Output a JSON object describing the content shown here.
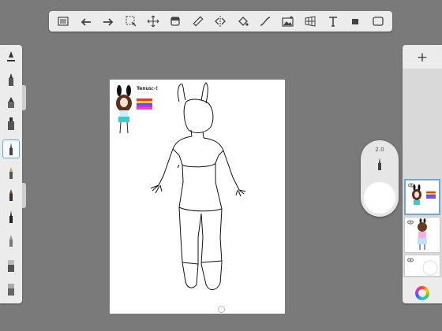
{
  "top_toolbar": {
    "icons": [
      "list-icon",
      "undo-icon",
      "redo-icon",
      "select-icon",
      "transform-icon",
      "layer-icon",
      "ruler-icon",
      "symmetry-icon",
      "fill-icon",
      "curve-icon",
      "import-image-icon",
      "perspective-icon",
      "text-icon",
      "stroke-icon",
      "fullscreen-icon"
    ]
  },
  "left_panel": {
    "brushes": [
      "brush-1",
      "brush-2",
      "brush-3",
      "brush-4",
      "brush-5",
      "brush-6",
      "brush-7",
      "brush-8",
      "brush-9",
      "brush-10"
    ],
    "active_brush": 3
  },
  "canvas": {
    "sticker_text": "Tenus:-!",
    "colors": {
      "rainbow": [
        "#ff3030",
        "#ffd400",
        "#30c050",
        "#3060ff",
        "#c030ff"
      ],
      "hair": "#5a2e1a",
      "dress": "#40c8d0"
    }
  },
  "puck": {
    "size_label": "2.0"
  },
  "right_panel": {
    "add_label": "+",
    "layers": [
      {
        "name": "layer-1",
        "active": true
      },
      {
        "name": "layer-2",
        "active": false
      },
      {
        "name": "layer-3",
        "active": false
      }
    ]
  }
}
